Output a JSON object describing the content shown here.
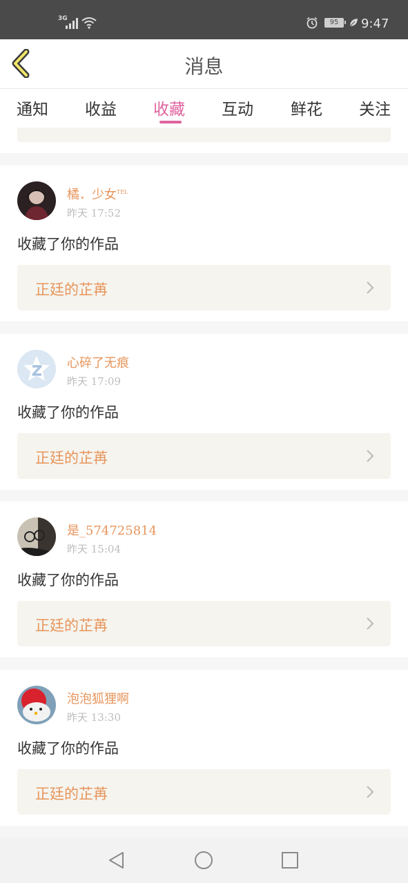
{
  "status_bar": {
    "network": "3G",
    "battery": "95",
    "time": "9:47"
  },
  "header": {
    "title": "消息",
    "back_icon": "chevron-left-icon"
  },
  "tabs": [
    {
      "label": "通知",
      "active": false
    },
    {
      "label": "收益",
      "active": false
    },
    {
      "label": "收藏",
      "active": true
    },
    {
      "label": "互动",
      "active": false
    },
    {
      "label": "鲜花",
      "active": false
    },
    {
      "label": "关注",
      "active": false
    }
  ],
  "accent_color": "#e0639e",
  "name_color": "#e7955c",
  "items": [
    {
      "username": "橘．少女",
      "username_mark": "TEL",
      "time": "昨天 17:52",
      "action": "收藏了你的作品",
      "work_title": "正廷的芷苒"
    },
    {
      "username": "心碎了无痕",
      "time": "昨天 17:09",
      "action": "收藏了你的作品",
      "work_title": "正廷的芷苒"
    },
    {
      "username": "是_574725814",
      "time": "昨天 15:04",
      "action": "收藏了你的作品",
      "work_title": "正廷的芷苒"
    },
    {
      "username": "泡泡狐狸啊",
      "time": "昨天 13:30",
      "action": "收藏了你的作品",
      "work_title": "正廷的芷苒"
    }
  ],
  "nav": {
    "back_icon": "triangle-back-icon",
    "home_icon": "circle-home-icon",
    "recents_icon": "square-recents-icon"
  }
}
